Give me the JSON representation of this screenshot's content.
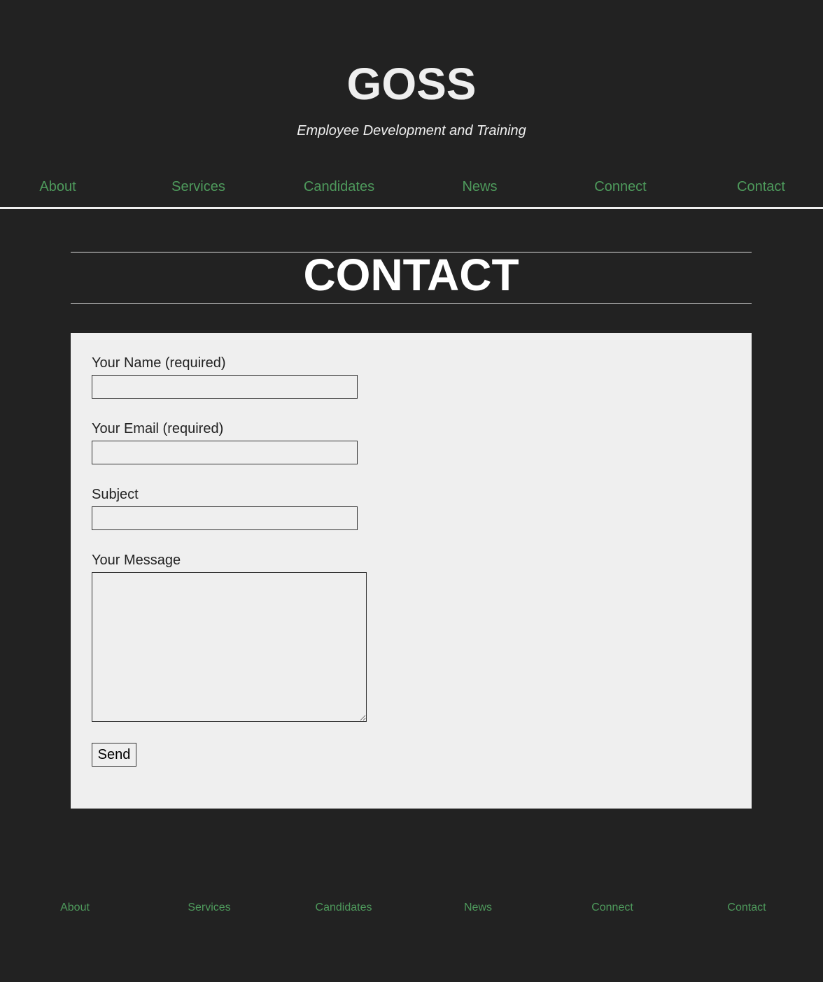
{
  "header": {
    "title": "GOSS",
    "tagline": "Employee Development and Training"
  },
  "nav": [
    "About",
    "Services",
    "Candidates",
    "News",
    "Connect",
    "Contact"
  ],
  "page": {
    "heading": "CONTACT"
  },
  "form": {
    "name_label": "Your Name (required)",
    "email_label": "Your Email (required)",
    "subject_label": "Subject",
    "message_label": "Your Message",
    "send_label": "Send"
  },
  "footer_nav": [
    "About",
    "Services",
    "Candidates",
    "News",
    "Connect",
    "Contact"
  ],
  "colors": {
    "background": "#222222",
    "link": "#4e9a5c",
    "panel": "#efefef"
  }
}
